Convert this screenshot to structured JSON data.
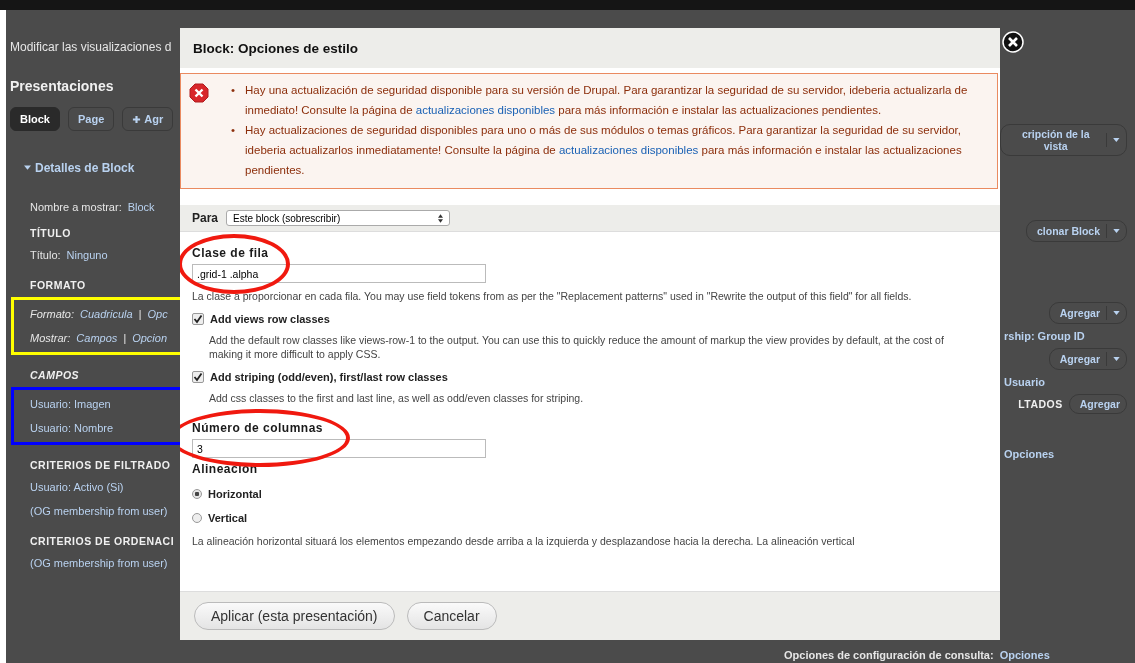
{
  "page": {
    "intro": "Modificar las visualizaciones d",
    "heading": "Presentaciones",
    "display_tabs": [
      {
        "label": "Block",
        "selected": true
      },
      {
        "label": "Page",
        "selected": false
      }
    ],
    "add_display": "Agr",
    "details_toggle": "Detalles de Block",
    "display_name": {
      "label": "Nombre a mostrar:",
      "value": "Block"
    },
    "sections": [
      {
        "title": "TÍTULO",
        "italic": false,
        "rows_italic": false,
        "rows": [
          {
            "label": "Título:",
            "value": "Ninguno"
          }
        ]
      },
      {
        "title": "FORMATO",
        "italic": false,
        "rows_italic": true,
        "color": "#ffff00",
        "rows": [
          {
            "label": "Formato:",
            "value": "Cuadricula",
            "separator": "|",
            "extra": "Opc"
          },
          {
            "label": "Mostrar:",
            "value": "Campos",
            "separator": "|",
            "extra": "Opcion"
          }
        ]
      },
      {
        "title": "CAMPOS",
        "italic": true,
        "rows_italic": false,
        "color": "#0000ff",
        "rows": [
          {
            "value": "Usuario: Imagen"
          },
          {
            "value": "Usuario: Nombre"
          }
        ]
      },
      {
        "title": "CRITERIOS DE FILTRADO",
        "italic": false,
        "rows_italic": false,
        "rows": [
          {
            "value": "Usuario: Activo (Si)"
          },
          {
            "value": "(OG membership from user)"
          }
        ]
      },
      {
        "title": "CRITERIOS DE ORDENACI",
        "italic": false,
        "rows_italic": false,
        "rows": [
          {
            "value": "(OG membership from user)"
          }
        ]
      }
    ],
    "right_items": [
      {
        "kind": "split_button",
        "text": "cripción de la vista"
      },
      {
        "kind": "split_button",
        "text": "clonar Block"
      },
      {
        "kind": "split_button",
        "text": "Agregar"
      },
      {
        "kind": "link",
        "text": "rship: Group ID"
      },
      {
        "kind": "split_button",
        "text": "Agregar"
      },
      {
        "kind": "link",
        "text": "Usuario"
      },
      {
        "kind": "heading_button",
        "text": "LTADOS",
        "button": "Agregar"
      },
      {
        "kind": "link",
        "text": "Opciones"
      }
    ],
    "query_settings": {
      "label": "Opciones de configuración de consulta:",
      "link": "Opciones"
    }
  },
  "dialog": {
    "title": "Block: Opciones de estilo",
    "messages": [
      {
        "bullet": "•",
        "before": "Hay una actualización de seguridad disponible para su versión de Drupal. Para garantizar la seguridad de su servidor, ideberia actualizarla de inmediato! Consulte la página de ",
        "link": "actualizaciones disponibles",
        "after": " para más información e instalar las actualizaciones pendientes."
      },
      {
        "bullet": "•",
        "before": "Hay actualizaciones de seguridad disponibles para uno o más de sus módulos o temas gráficos. Para garantizar la seguridad de su servidor, ideberia actualizarlos inmediatamente! Consulte la página de ",
        "link": "actualizaciones disponibles",
        "after": " para más información e instalar las actualizaciones pendientes."
      }
    ],
    "for_label": "Para",
    "for_select": "Este block (sobrescribir)",
    "fields": [
      {
        "kind": "text",
        "label": "Clase de fila",
        "value": ".grid-1 .alpha",
        "circled": true,
        "description": "La clase a proporcionar en cada fila. You may use field tokens from as per the \"Replacement patterns\" used in \"Rewrite the output of this field\" for all fields."
      },
      {
        "kind": "checkbox",
        "label": "Add views row classes",
        "checked": true,
        "description": "Add the default row classes like views-row-1 to the output. You can use this to quickly reduce the amount of markup the view provides by default, at the cost of making it more difficult to apply CSS."
      },
      {
        "kind": "checkbox",
        "label": "Add striping (odd/even), first/last row classes",
        "checked": true,
        "description": "Add css classes to the first and last line, as well as odd/even classes for striping."
      },
      {
        "kind": "text",
        "label": "Número de columnas",
        "value": "3",
        "circled": true
      },
      {
        "kind": "radios",
        "label": "Alineación",
        "options": [
          {
            "label": "Horizontal",
            "selected": true
          },
          {
            "label": "Vertical",
            "selected": false
          }
        ],
        "description": "La alineación horizontal situará los elementos empezando desde arriba a la izquierda y desplazandose hacia la derecha. La alineación vertical"
      }
    ],
    "buttons": [
      "Aplicar (esta presentación)",
      "Cancelar"
    ]
  }
}
